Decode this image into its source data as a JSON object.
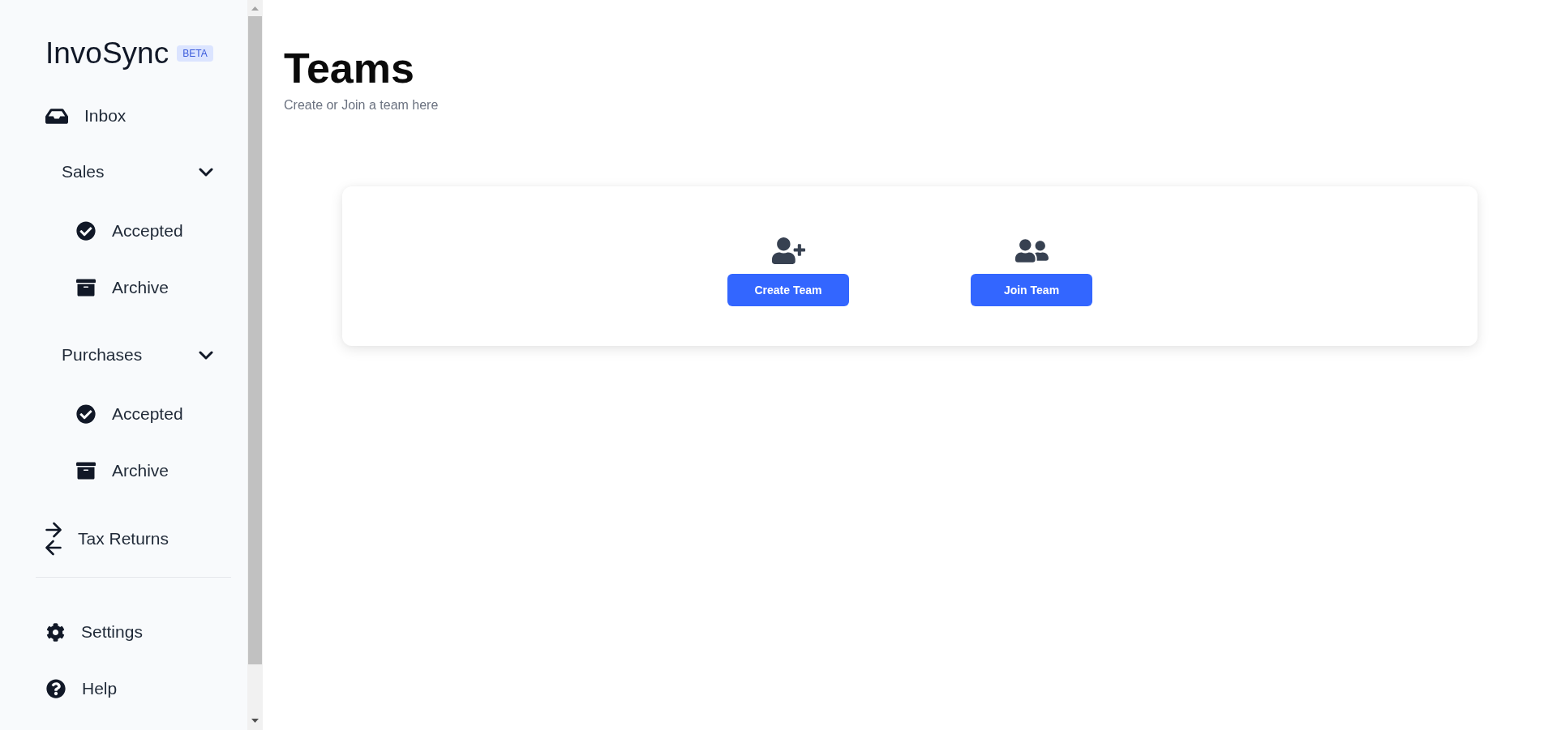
{
  "sidebar": {
    "brand": "InvoSync",
    "badge": "BETA",
    "nav": [
      {
        "kind": "link",
        "label": "Inbox"
      },
      {
        "kind": "group",
        "label": "Sales",
        "expanded": true,
        "children": [
          {
            "label": "Accepted"
          },
          {
            "label": "Archive"
          }
        ]
      },
      {
        "kind": "group",
        "label": "Purchases",
        "expanded": true,
        "children": [
          {
            "label": "Accepted"
          },
          {
            "label": "Archive"
          }
        ]
      },
      {
        "kind": "link",
        "label": "Tax Returns"
      }
    ],
    "footer": [
      {
        "label": "Settings"
      },
      {
        "label": "Help"
      }
    ]
  },
  "header": {
    "title": "Teams",
    "subtitle": "Create or Join a team here"
  },
  "actions": [
    {
      "label": "Create Team"
    },
    {
      "label": "Join Team"
    }
  ]
}
